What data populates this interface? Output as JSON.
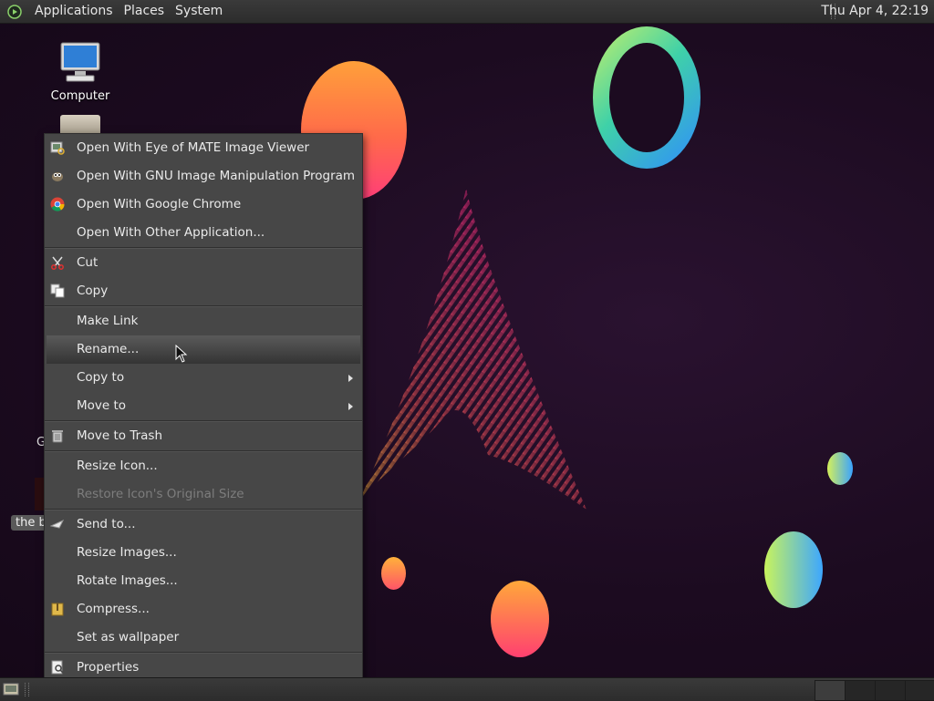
{
  "top_panel": {
    "menus": [
      "Applications",
      "Places",
      "System"
    ],
    "clock": "Thu Apr  4, 22:19"
  },
  "desktop": {
    "computer_label": "Computer",
    "partial_label": "G",
    "file_label": "the b"
  },
  "context_menu": {
    "items": [
      {
        "label": "Open With Eye of MATE Image Viewer",
        "icon": "image-viewer-icon"
      },
      {
        "label": "Open With GNU Image Manipulation Program",
        "icon": "gimp-icon"
      },
      {
        "label": "Open With Google Chrome",
        "icon": "chrome-icon"
      },
      {
        "label": "Open With Other Application..."
      },
      {
        "label": "Cut",
        "icon": "scissors-icon"
      },
      {
        "label": "Copy",
        "icon": "copy-icon"
      },
      {
        "label": "Make Link"
      },
      {
        "label": "Rename...",
        "highlighted": true
      },
      {
        "label": "Copy to",
        "submenu": true
      },
      {
        "label": "Move to",
        "submenu": true
      },
      {
        "label": "Move to Trash",
        "icon": "trash-icon"
      },
      {
        "label": "Resize Icon..."
      },
      {
        "label": "Restore Icon's Original Size",
        "disabled": true
      },
      {
        "label": "Send to...",
        "icon": "send-icon"
      },
      {
        "label": "Resize Images..."
      },
      {
        "label": "Rotate Images..."
      },
      {
        "label": "Compress...",
        "icon": "archive-icon"
      },
      {
        "label": "Set as wallpaper"
      },
      {
        "label": "Properties",
        "icon": "properties-icon"
      }
    ]
  },
  "colors": {
    "menu_bg": "#474747",
    "panel_bg": "#333333",
    "desktop_bg": "#1c0b20"
  }
}
